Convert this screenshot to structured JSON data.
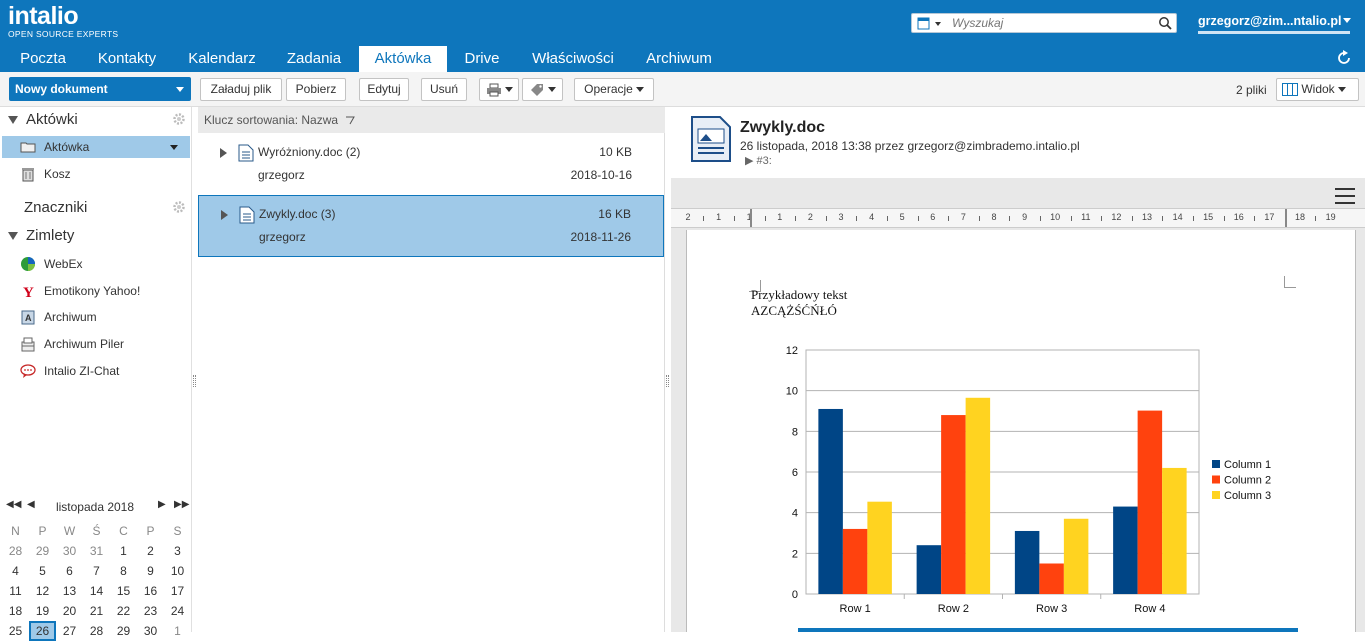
{
  "app": {
    "logo_text": "intalio",
    "logo_sub": "OPEN SOURCE EXPERTS"
  },
  "search": {
    "placeholder": "Wyszukaj"
  },
  "user": {
    "name": "grzegorz@zim...ntalio.pl"
  },
  "tabs": [
    {
      "label": "Poczta"
    },
    {
      "label": "Kontakty"
    },
    {
      "label": "Kalendarz"
    },
    {
      "label": "Zadania"
    },
    {
      "label": "Aktówka"
    },
    {
      "label": "Drive"
    },
    {
      "label": "Właściwości"
    },
    {
      "label": "Archiwum"
    }
  ],
  "toolbar": {
    "new_doc": "Nowy dokument",
    "upload": "Załaduj plik",
    "download": "Pobierz",
    "edit": "Edytuj",
    "delete": "Usuń",
    "operations": "Operacje",
    "file_count": "2 pliki",
    "view": "Widok"
  },
  "sidebar": {
    "briefcases_header": "Aktówki",
    "briefcases": [
      {
        "label": "Aktówka"
      },
      {
        "label": "Kosz"
      }
    ],
    "tags_header": "Znaczniki",
    "zimlets_header": "Zimlety",
    "zimlets": [
      {
        "label": "WebEx"
      },
      {
        "label": "Emotikony Yahoo!"
      },
      {
        "label": "Archiwum"
      },
      {
        "label": "Archiwum Piler"
      },
      {
        "label": "Intalio ZI-Chat"
      }
    ]
  },
  "calendar": {
    "title": "listopada 2018",
    "weekdays": [
      "N",
      "P",
      "W",
      "Ś",
      "C",
      "P",
      "S"
    ],
    "weeks": [
      [
        "28",
        "29",
        "30",
        "31",
        "1",
        "2",
        "3"
      ],
      [
        "4",
        "5",
        "6",
        "7",
        "8",
        "9",
        "10"
      ],
      [
        "11",
        "12",
        "13",
        "14",
        "15",
        "16",
        "17"
      ],
      [
        "18",
        "19",
        "20",
        "21",
        "22",
        "23",
        "24"
      ],
      [
        "25",
        "26",
        "27",
        "28",
        "29",
        "30",
        "1"
      ]
    ],
    "today": "26"
  },
  "filelist": {
    "sort_label": "Klucz sortowania: Nazwa",
    "files": [
      {
        "name": "Wyróżniony.doc (2)",
        "size": "10 KB",
        "owner": "grzegorz",
        "date": "2018-10-16"
      },
      {
        "name": "Zwykly.doc (3)",
        "size": "16 KB",
        "owner": "grzegorz",
        "date": "2018-11-26"
      }
    ]
  },
  "preview": {
    "title": "Zwykly.doc",
    "meta": "26 listopada, 2018 13:38 przez grzegorz@zimbrademo.intalio.pl",
    "version": "#3:",
    "doc_line1": "Przykładowy tekst",
    "doc_line2": "AZCĄŻŚĆŃŁÓ"
  },
  "chart_data": {
    "type": "bar",
    "categories": [
      "Row 1",
      "Row 2",
      "Row 3",
      "Row 4"
    ],
    "series": [
      {
        "name": "Column 1",
        "color": "#004586",
        "values": [
          9.1,
          2.4,
          3.1,
          4.3
        ]
      },
      {
        "name": "Column 2",
        "color": "#ff420e",
        "values": [
          3.2,
          8.8,
          1.5,
          9.02
        ]
      },
      {
        "name": "Column 3",
        "color": "#ffd320",
        "values": [
          4.54,
          9.65,
          3.7,
          6.2
        ]
      }
    ],
    "yticks": [
      "0",
      "2",
      "4",
      "6",
      "8",
      "10",
      "12"
    ],
    "ylim": [
      0,
      12
    ],
    "grid": true,
    "legend": "right"
  },
  "ruler": {
    "labels": [
      "2",
      "1",
      "1",
      "1",
      "2",
      "3",
      "4",
      "5",
      "6",
      "7",
      "8",
      "9",
      "10",
      "11",
      "12",
      "13",
      "14",
      "15",
      "16",
      "17",
      "18",
      "19"
    ]
  }
}
